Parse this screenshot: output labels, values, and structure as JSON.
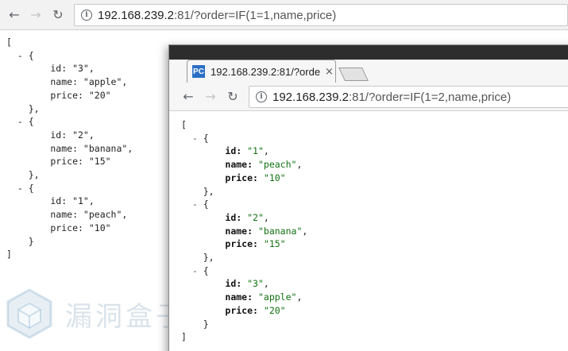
{
  "back_window": {
    "address": {
      "host": "192.168.239.2",
      "rest": ":81/?order=IF(1=1,name,price)"
    },
    "json_text": "[\n  - {\n        id: \"3\",\n        name: \"apple\",\n        price: \"20\"\n    },\n  - {\n        id: \"2\",\n        name: \"banana\",\n        price: \"15\"\n    },\n  - {\n        id: \"1\",\n        name: \"peach\",\n        price: \"10\"\n    }\n]",
    "records": [
      {
        "id": "3",
        "name": "apple",
        "price": "20"
      },
      {
        "id": "2",
        "name": "banana",
        "price": "15"
      },
      {
        "id": "1",
        "name": "peach",
        "price": "10"
      }
    ]
  },
  "front_window": {
    "tab": {
      "favicon_text": "PC",
      "title": "192.168.239.2:81/?orde",
      "close": "×"
    },
    "address": {
      "host": "192.168.239.2",
      "rest": ":81/?order=IF(1=2,name,price)"
    },
    "records": [
      {
        "id": "1",
        "name": "peach",
        "price": "10"
      },
      {
        "id": "2",
        "name": "banana",
        "price": "15"
      },
      {
        "id": "3",
        "name": "apple",
        "price": "20"
      }
    ]
  },
  "watermark": {
    "text": "漏洞盒子"
  },
  "icons": {
    "back": "arrow-left-icon",
    "forward": "arrow-right-icon",
    "reload": "reload-icon",
    "info": "info-icon",
    "favicon": "pc-favicon-icon",
    "close": "close-icon",
    "new_tab": "new-tab-icon",
    "watermark_logo": "cube-logo-icon"
  },
  "colors": {
    "string_value": "#107010",
    "key": "#111111",
    "favicon_bg": "#2a6fc6",
    "frame": "#2d2d2d"
  }
}
